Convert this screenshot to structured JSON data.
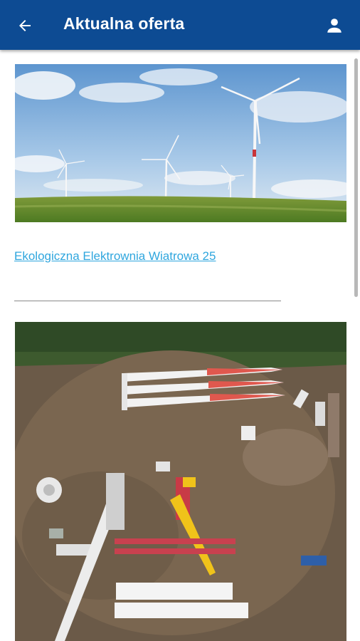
{
  "appbar": {
    "title": "Aktualna oferta",
    "back_icon": "arrow-left-icon",
    "profile_icon": "person-icon",
    "background": "#0d4b93"
  },
  "offer": {
    "link_label": "Ekologiczna Elektrownia Wiatrowa 25",
    "link_color": "#2fa6de"
  }
}
